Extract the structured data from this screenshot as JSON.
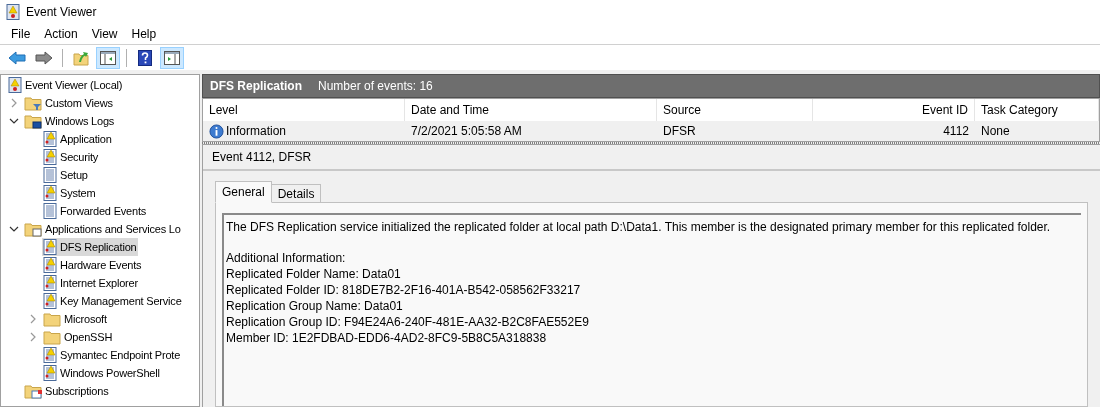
{
  "window": {
    "title": "Event Viewer"
  },
  "menu": [
    "File",
    "Action",
    "View",
    "Help"
  ],
  "toolbar": [
    {
      "kind": "back",
      "pressed": false
    },
    {
      "kind": "forward",
      "pressed": false
    },
    {
      "kind": "separator"
    },
    {
      "kind": "up",
      "pressed": false
    },
    {
      "kind": "console-tree",
      "pressed": true
    },
    {
      "kind": "separator"
    },
    {
      "kind": "help",
      "pressed": false
    },
    {
      "kind": "action-pane",
      "pressed": true
    }
  ],
  "tree": [
    {
      "label": "Event Viewer (Local)",
      "kind": "viewer",
      "selected": false,
      "children": [
        {
          "label": "Custom Views",
          "kind": "folder-filter",
          "expanded": false,
          "selected": false
        },
        {
          "label": "Windows Logs",
          "kind": "folder-computer",
          "expanded": true,
          "selected": false,
          "children": [
            {
              "label": "Application",
              "kind": "log-warning",
              "selected": false
            },
            {
              "label": "Security",
              "kind": "log-warning",
              "selected": false
            },
            {
              "label": "Setup",
              "kind": "log",
              "selected": false
            },
            {
              "label": "System",
              "kind": "log-warning",
              "selected": false
            },
            {
              "label": "Forwarded Events",
              "kind": "log",
              "selected": false
            }
          ]
        },
        {
          "label": "Applications and Services Lo",
          "kind": "folder-window",
          "expanded": true,
          "selected": false,
          "children": [
            {
              "label": "DFS Replication",
              "kind": "log-warning",
              "selected": true
            },
            {
              "label": "Hardware Events",
              "kind": "log-warning",
              "selected": false
            },
            {
              "label": "Internet Explorer",
              "kind": "log-warning",
              "selected": false
            },
            {
              "label": "Key Management Service",
              "kind": "log-warning",
              "selected": false
            },
            {
              "label": "Microsoft",
              "kind": "folder",
              "expanded": false,
              "selected": false
            },
            {
              "label": "OpenSSH",
              "kind": "folder",
              "expanded": false,
              "selected": false
            },
            {
              "label": "Symantec Endpoint Prote",
              "kind": "log-warning",
              "selected": false
            },
            {
              "label": "Windows PowerShell",
              "kind": "log-warning",
              "selected": false
            }
          ]
        },
        {
          "label": "Subscriptions",
          "kind": "subscriptions",
          "selected": false
        }
      ]
    }
  ],
  "log_header": {
    "title": "DFS Replication",
    "count": "Number of events: 16"
  },
  "table": {
    "columns": [
      "Level",
      "Date and Time",
      "Source",
      "Event ID",
      "Task Category"
    ],
    "rows": [
      {
        "kind": "information",
        "selected": true,
        "cells": [
          "Information",
          "7/2/2021 5:05:58 AM",
          "DFSR",
          "4112",
          "None"
        ]
      }
    ]
  },
  "detail": {
    "title": "Event 4112, DFSR",
    "tabs": [
      {
        "label": "General",
        "selected": true
      },
      {
        "label": "Details",
        "selected": false
      }
    ],
    "description": "The DFS Replication service initialized the replicated folder at local path D:\\Data1. This member is the designated primary member for this replicated folder.",
    "info_lines": [
      "Additional Information:",
      "Replicated Folder Name: Data01",
      "Replicated Folder ID: 818DE7B2-2F16-401A-B542-058562F33217",
      "Replication Group Name: Data01",
      "Replication Group ID: F94E24A6-240F-481E-AA32-B2C8FAE552E9",
      "Member ID: 1E2FDBAD-EDD6-4AD2-8FC9-5B8C5A318838"
    ]
  }
}
